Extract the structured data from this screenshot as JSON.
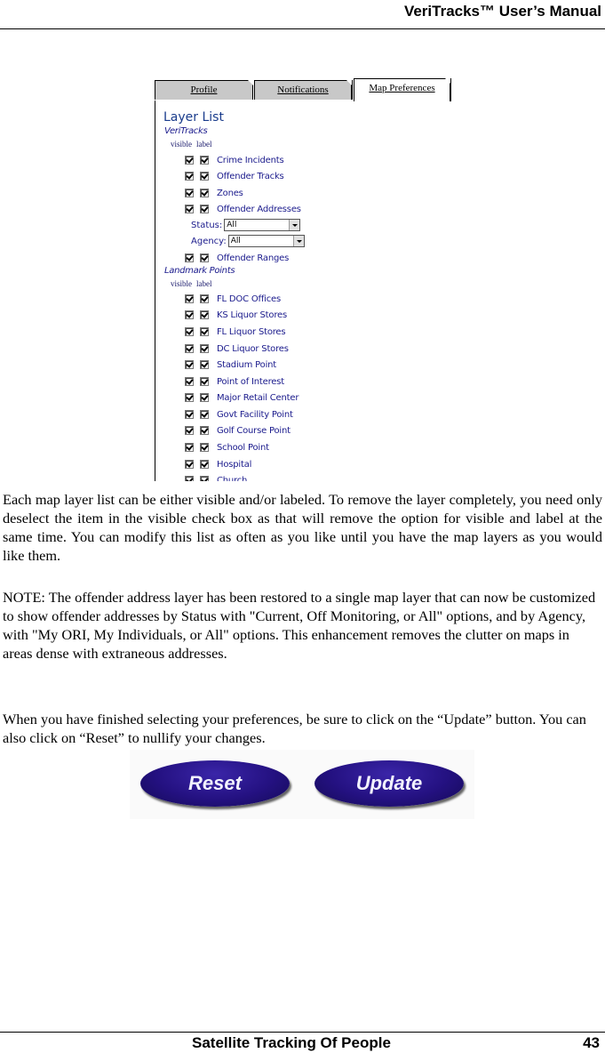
{
  "header": {
    "title": "VeriTracks™ User’s Manual"
  },
  "screenshot": {
    "tabs": [
      {
        "label": "Profile",
        "active": false
      },
      {
        "label": "Notifications",
        "active": false
      },
      {
        "label": "Map Preferences",
        "active": true
      }
    ],
    "layer_list_title": "Layer List",
    "groups": [
      {
        "title": "VeriTracks",
        "col_visible": "visible",
        "col_label": "label",
        "items": [
          {
            "label": "Crime Incidents",
            "visible": true,
            "labeled": true
          },
          {
            "label": "Offender Tracks",
            "visible": true,
            "labeled": true
          },
          {
            "label": "Zones",
            "visible": true,
            "labeled": true
          },
          {
            "label": "Offender Addresses",
            "visible": true,
            "labeled": true
          },
          {
            "label": "Offender Ranges",
            "visible": true,
            "labeled": true
          }
        ],
        "filters": [
          {
            "label": "Status:",
            "value": "All"
          },
          {
            "label": "Agency:",
            "value": "All"
          }
        ]
      },
      {
        "title": "Landmark Points",
        "col_visible": "visible",
        "col_label": "label",
        "items": [
          {
            "label": "FL DOC Offices",
            "visible": true,
            "labeled": true
          },
          {
            "label": "KS Liquor Stores",
            "visible": true,
            "labeled": true
          },
          {
            "label": "FL Liquor Stores",
            "visible": true,
            "labeled": true
          },
          {
            "label": "DC Liquor Stores",
            "visible": true,
            "labeled": true
          },
          {
            "label": "Stadium Point",
            "visible": true,
            "labeled": true
          },
          {
            "label": "Point of Interest",
            "visible": true,
            "labeled": true
          },
          {
            "label": "Major Retail Center",
            "visible": true,
            "labeled": true
          },
          {
            "label": "Govt Facility Point",
            "visible": true,
            "labeled": true
          },
          {
            "label": "Golf Course Point",
            "visible": true,
            "labeled": true
          },
          {
            "label": "School Point",
            "visible": true,
            "labeled": true
          },
          {
            "label": "Hospital",
            "visible": true,
            "labeled": true
          },
          {
            "label": "Church",
            "visible": true,
            "labeled": true
          }
        ]
      }
    ]
  },
  "body": {
    "paragraph1": "Each map layer list can be either visible and/or labeled.  To remove the layer completely, you need only deselect the item in the visible check box as that will remove the option for visible and label at the same time.  You can modify this list as often as you like until you have the map layers as you would like them.",
    "paragraph2": "NOTE:  The offender address layer has been restored to a single map layer that can now be customized to show offender addresses by Status with  \"Current, Off Monitoring, or All\" options, and by Agency, with \"My ORI, My Individuals, or All\" options.  This enhancement removes the clutter on maps in areas dense with extraneous addresses.",
    "paragraph3": "When you have finished selecting your preferences, be sure to click on the “Update” button.  You can also click on “Reset” to nullify your changes."
  },
  "buttons": {
    "reset": "Reset",
    "update": "Update"
  },
  "footer": {
    "section": "Satellite Tracking Of People",
    "page_number": "43"
  }
}
